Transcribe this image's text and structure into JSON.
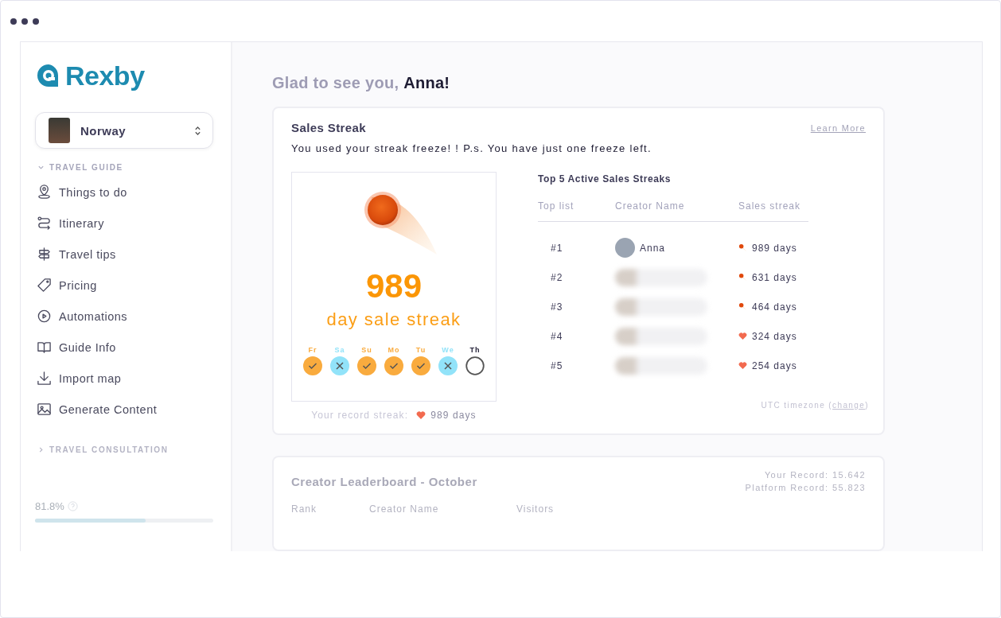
{
  "brand": {
    "name": "Rexby"
  },
  "guide_selector": {
    "value": "Norway"
  },
  "sidebar": {
    "sections": [
      {
        "label": "TRAVEL GUIDE",
        "expanded": true,
        "items": [
          {
            "label": "Things to do"
          },
          {
            "label": "Itinerary"
          },
          {
            "label": "Travel tips"
          },
          {
            "label": "Pricing"
          },
          {
            "label": "Automations"
          },
          {
            "label": "Guide Info"
          },
          {
            "label": "Import map"
          },
          {
            "label": "Generate Content"
          }
        ]
      },
      {
        "label": "TRAVEL CONSULTATION",
        "expanded": false
      }
    ],
    "progress": {
      "reading": "81.8%",
      "level": 0.62
    }
  },
  "greeting": {
    "prefix": "Glad to see you,",
    "name": "Anna!"
  },
  "streak_card": {
    "title": "Sales Streak",
    "learn_more": "Learn More",
    "message": "You used your streak freeze! ! P.s. You have just one freeze left.",
    "count": "989",
    "caption": "day sale streak",
    "days": [
      {
        "label": "Fr",
        "kind": "done"
      },
      {
        "label": "Sa",
        "kind": "frozen"
      },
      {
        "label": "Su",
        "kind": "done"
      },
      {
        "label": "Mo",
        "kind": "done"
      },
      {
        "label": "Tu",
        "kind": "done"
      },
      {
        "label": "We",
        "kind": "frozen"
      },
      {
        "label": "Th",
        "kind": "pending"
      }
    ],
    "record_label": "Your record streak:",
    "record_value": "989 days",
    "top_title": "Top 5 Active Sales Streaks",
    "columns": [
      "Top list",
      "Creator Name",
      "Sales streak"
    ],
    "rows": [
      {
        "rank": "#1",
        "name": "Anna",
        "blurred": false,
        "kind": "fire",
        "streak": "989 days"
      },
      {
        "rank": "#2",
        "blurred": true,
        "kind": "fire",
        "streak": "631 days"
      },
      {
        "rank": "#3",
        "blurred": true,
        "kind": "fire",
        "streak": "464 days"
      },
      {
        "rank": "#4",
        "blurred": true,
        "kind": "heart",
        "streak": "324 days"
      },
      {
        "rank": "#5",
        "blurred": true,
        "kind": "heart",
        "streak": "254 days"
      }
    ],
    "timezone": "UTC timezone (",
    "timezone_link": "change",
    "timezone_end": ")"
  },
  "leaderboard_card": {
    "title": "Creator Leaderboard - October",
    "your_record": "Your Record: 15.642",
    "platform_record": "Platform Record: 55.823",
    "columns": [
      "Rank",
      "Creator Name",
      "Visitors"
    ]
  }
}
